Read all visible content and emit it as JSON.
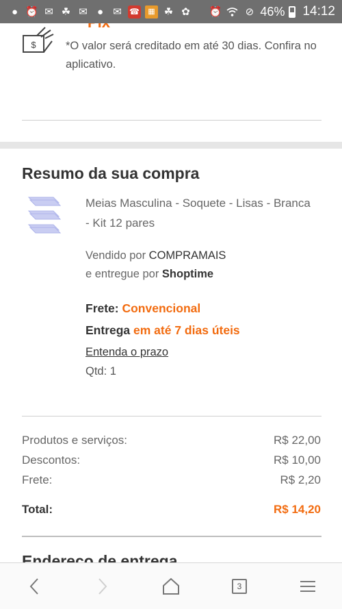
{
  "status_bar": {
    "battery_percent": "46%",
    "time": "14:12",
    "left_icons": [
      "message-icon",
      "alarm-icon",
      "mail-icon",
      "leaf-icon",
      "mail-icon",
      "bulb-icon",
      "mail-icon",
      "phone-icon",
      "app-icon",
      "leaf-icon",
      "octopus-icon"
    ],
    "right_icons": [
      "alarm-icon",
      "wifi-icon",
      "do-not-disturb-icon",
      "battery-icon"
    ]
  },
  "payment": {
    "cut_heading": "Pix",
    "note": "*O valor será creditado em até 30 dias. Confira no aplicativo."
  },
  "summary": {
    "title": "Resumo da sua compra",
    "product_name": "Meias Masculina - Soquete - Lisas - Branca - Kit 12 pares",
    "sold_by_prefix": "Vendido por ",
    "seller": "COMPRAMAIS",
    "delivered_by_prefix": "e entregue por ",
    "delivered_by": "Shoptime",
    "shipping_label": "Frete: ",
    "shipping_value": "Convencional",
    "delivery_label": "Entrega ",
    "delivery_value": "em até 7 dias úteis",
    "deadline_link": "Entenda o prazo",
    "qty": "Qtd: 1"
  },
  "totals": {
    "rows": [
      {
        "label": "Produtos e serviços:",
        "value": "R$ 22,00"
      },
      {
        "label": "Descontos:",
        "value": "R$ 10,00"
      },
      {
        "label": "Frete:",
        "value": "R$ 2,20"
      }
    ],
    "total_label": "Total:",
    "total_value": "R$ 14,20"
  },
  "address": {
    "title": "Endereço de entrega"
  },
  "browser_nav": {
    "tab_count": "3",
    "icons": [
      "back-icon",
      "forward-icon",
      "home-icon",
      "tabs-icon",
      "menu-icon"
    ]
  },
  "colors": {
    "accent": "#f26b0f",
    "status_bar": "#6f6f6f"
  }
}
